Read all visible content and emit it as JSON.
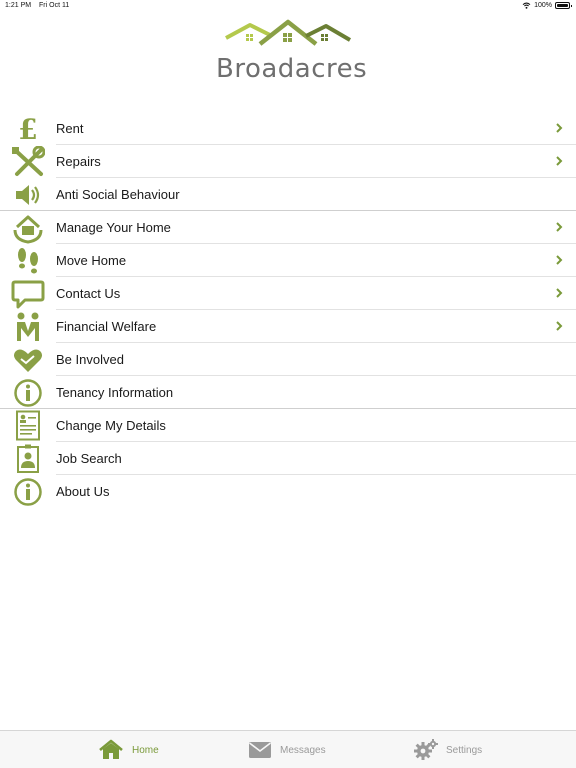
{
  "status_bar": {
    "time": "1:21 PM",
    "date": "Fri Oct 11",
    "battery": "100%"
  },
  "logo": {
    "text": "Broadacres"
  },
  "colors": {
    "accent": "#7a9a3a",
    "icon_green": "#8aa046",
    "chevron": "#7a9a3a",
    "tab_inactive": "#9a9a9a"
  },
  "menu": {
    "items": [
      {
        "label": "Rent",
        "icon": "pound-icon",
        "chevron": true
      },
      {
        "label": "Repairs",
        "icon": "tools-icon",
        "chevron": true
      },
      {
        "label": "Anti Social Behaviour",
        "icon": "speaker-icon",
        "chevron": false
      },
      {
        "label": "Manage Your Home",
        "icon": "house-hands-icon",
        "chevron": true
      },
      {
        "label": "Move Home",
        "icon": "footprints-icon",
        "chevron": true
      },
      {
        "label": "Contact Us",
        "icon": "speech-bubble-icon",
        "chevron": true
      },
      {
        "label": "Financial Welfare",
        "icon": "people-icon",
        "chevron": true
      },
      {
        "label": "Be Involved",
        "icon": "heart-hands-icon",
        "chevron": false
      },
      {
        "label": "Tenancy Information",
        "icon": "info-icon",
        "chevron": false
      },
      {
        "label": "Change My Details",
        "icon": "form-icon",
        "chevron": false
      },
      {
        "label": "Job Search",
        "icon": "id-badge-icon",
        "chevron": false
      },
      {
        "label": "About Us",
        "icon": "info-icon",
        "chevron": false
      }
    ]
  },
  "tabbar": {
    "home": {
      "label": "Home",
      "icon": "home-icon"
    },
    "messages": {
      "label": "Messages",
      "icon": "envelope-icon"
    },
    "settings": {
      "label": "Settings",
      "icon": "gears-icon"
    }
  }
}
